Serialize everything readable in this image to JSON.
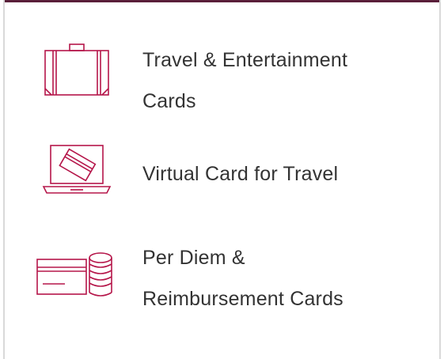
{
  "menu": {
    "items": [
      {
        "label_line1": "Travel & Entertainment",
        "label_line2": "Cards",
        "icon": "suitcase-icon"
      },
      {
        "label_line1": "Virtual Card for Travel",
        "label_line2": "",
        "icon": "laptop-card-icon"
      },
      {
        "label_line1": "Per Diem &",
        "label_line2": "Reimbursement Cards",
        "icon": "card-coins-icon"
      }
    ]
  },
  "colors": {
    "accent": "#b5164a",
    "top_border": "#5a1f3a",
    "text": "#333333",
    "panel_border": "#d9d9d9"
  }
}
